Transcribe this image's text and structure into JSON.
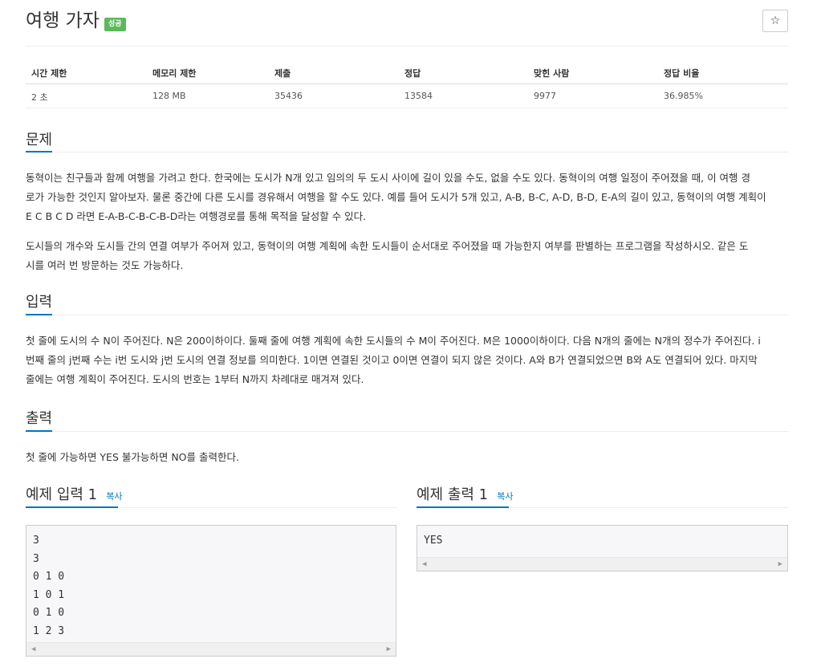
{
  "header": {
    "title": "여행 가자",
    "badge": "성공",
    "star_icon": "☆"
  },
  "stats": {
    "headers": [
      "시간 제한",
      "메모리 제한",
      "제출",
      "정답",
      "맞힌 사람",
      "정답 비율"
    ],
    "values": [
      "2 초",
      "128 MB",
      "35436",
      "13584",
      "9977",
      "36.985%"
    ]
  },
  "problem": {
    "title": "문제",
    "p1": [
      "동혁이는 친구들과 함께 여행을 가려고 한다. 한국에는 도시가 N개 있고 임의의 두 도시 사이에 길이 있을 수도, 없을 수도 있다. 동혁이의 여행 일정이 주어졌을 때, 이 여행 경",
      "로가 가능한 것인지 알아보자. 물론 중간에 다른 도시를 경유해서 여행을 할 수도 있다. 예를 들어 도시가 5개 있고, A-B, B-C, A-D, B-D, E-A의 길이 있고, 동혁이의 여행 계획이",
      "E C B C D 라면 E-A-B-C-B-C-B-D라는 여행경로를 통해 목적을 달성할 수 있다."
    ],
    "p2": [
      "도시들의 개수와 도시들 간의 연결 여부가 주어져 있고, 동혁이의 여행 계획에 속한 도시들이 순서대로 주어졌을 때 가능한지 여부를 판별하는 프로그램을 작성하시오. 같은 도",
      "시를 여러 번 방문하는 것도 가능하다."
    ]
  },
  "input": {
    "title": "입력",
    "lines": [
      "첫 줄에 도시의 수 N이 주어진다. N은 200이하이다. 둘째 줄에 여행 계획에 속한 도시들의 수 M이 주어진다. M은 1000이하이다. 다음 N개의 줄에는 N개의 정수가 주어진다. i",
      "번째 줄의 j번째 수는 i번 도시와 j번 도시의 연결 정보를 의미한다. 1이면 연결된 것이고 0이면 연결이 되지 않은 것이다. A와 B가 연결되었으면 B와 A도 연결되어 있다. 마지막",
      "줄에는 여행 계획이 주어진다. 도시의 번호는 1부터 N까지 차례대로 매겨져 있다."
    ]
  },
  "output": {
    "title": "출력",
    "lines": [
      "첫 줄에 가능하면 YES 불가능하면 NO를 출력한다."
    ]
  },
  "examples": {
    "copy_label": "복사",
    "input_title": "예제 입력 1",
    "output_title": "예제 출력 1",
    "input_code": "3\n3\n0 1 0\n1 0 1\n0 1 0\n1 2 3",
    "output_code": "YES"
  }
}
